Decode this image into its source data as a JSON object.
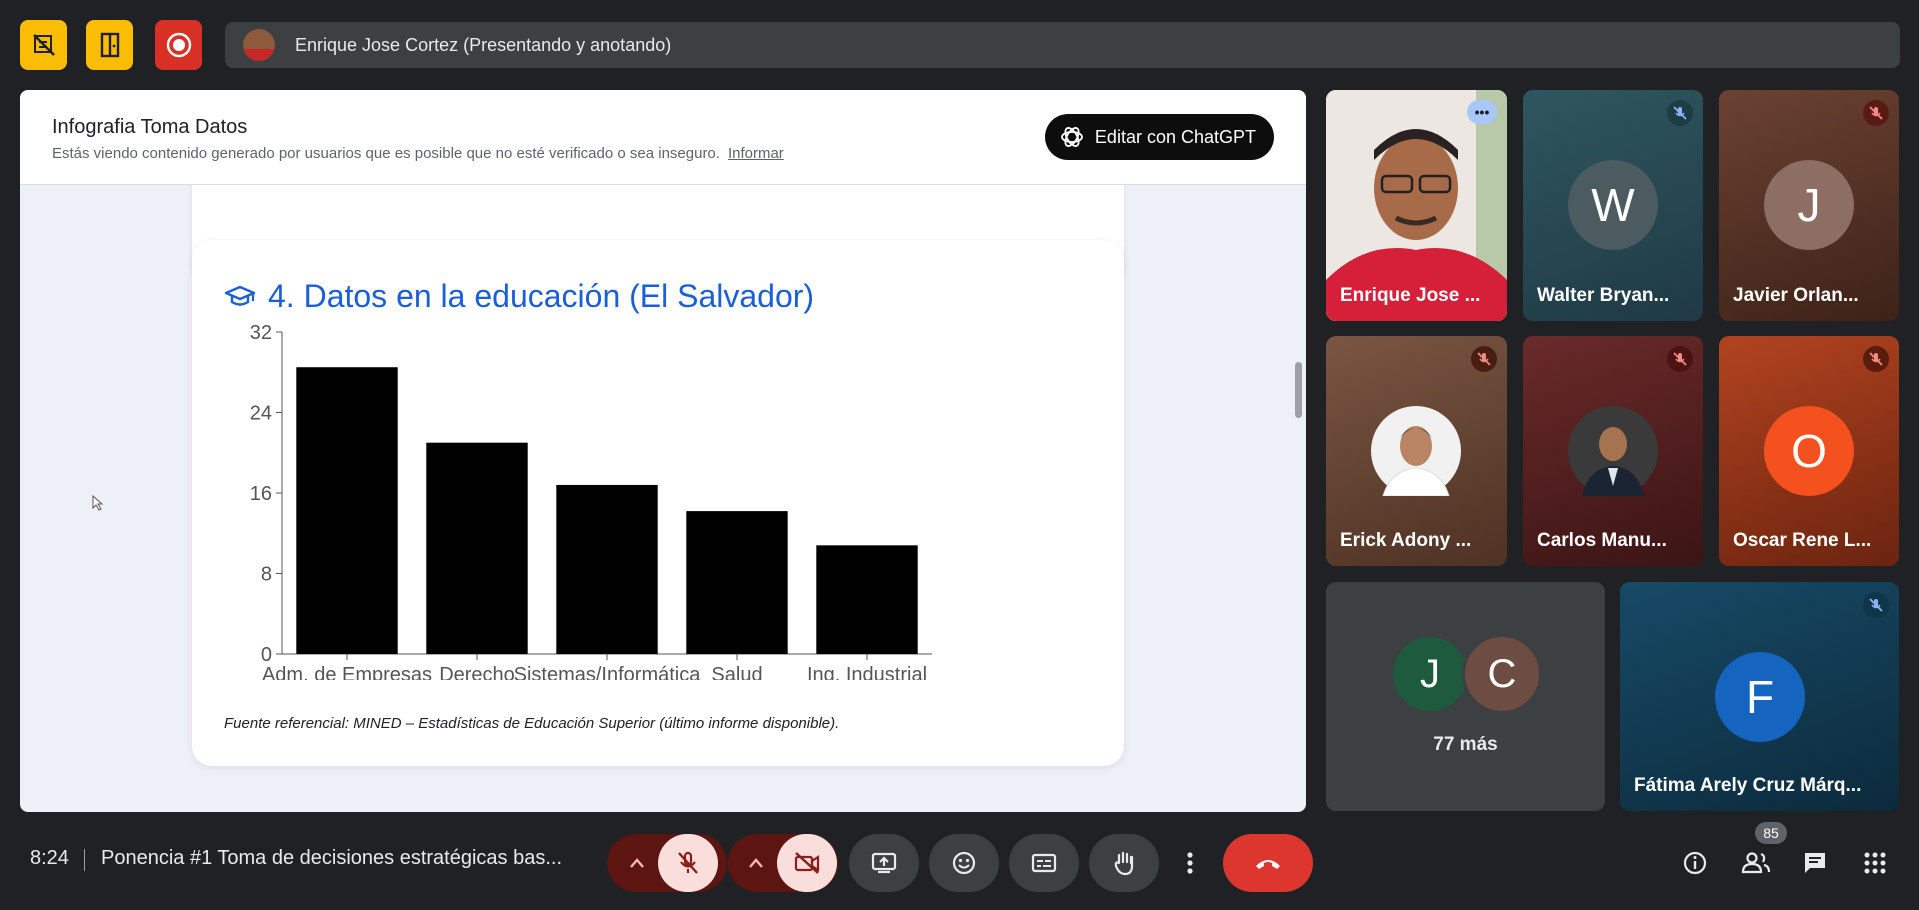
{
  "topbar": {
    "presenter_text": "Enrique Jose Cortez (Presentando y anotando)",
    "buttons": [
      "no-camera-zone-icon",
      "door-exit-icon",
      "record-icon"
    ]
  },
  "presentation": {
    "title": "Infografia Toma Datos",
    "warning": "Estás viendo contenido generado por usuarios que es posible que no esté verificado o sea inseguro.",
    "report_link": "Informar",
    "edit_button": "Editar con ChatGPT",
    "card": {
      "title": "4. Datos en la educación (El Salvador)",
      "source": "Fuente referencial: MINED – Estadísticas de Educación Superior (último informe disponible)."
    }
  },
  "chart_data": {
    "type": "bar",
    "categories": [
      "Adm. de Empresas",
      "Derecho",
      "Sistemas/Informática",
      "Salud",
      "Ing. Industrial"
    ],
    "values": [
      28.5,
      21,
      16.8,
      14.2,
      10.8
    ],
    "yticks": [
      "0",
      "8",
      "16",
      "24",
      "32"
    ],
    "ylim": [
      0,
      32
    ],
    "bar_color": "#000000"
  },
  "participants": [
    {
      "name": "Enrique Jose ...",
      "bg": "#b71c2c",
      "speaking": true
    },
    {
      "name": "Walter Bryan...",
      "initial": "W",
      "avatar_color": "#4a5a60",
      "bg": "#2b4d55"
    },
    {
      "name": "Javier Orlan...",
      "initial": "J",
      "avatar_color": "#8d6e63",
      "bg": "#5a3a2e"
    },
    {
      "name": "Erick Adony ...",
      "bg": "#6d4c3a"
    },
    {
      "name": "Carlos Manu...",
      "bg": "#5b2424"
    },
    {
      "name": "Oscar Rene L...",
      "initial": "O",
      "avatar_color": "#f4511e",
      "bg": "#a03818"
    },
    {
      "more_label": "77 más",
      "initials": [
        "J",
        "C"
      ]
    },
    {
      "name": "Fátima Arely Cruz Márq...",
      "initial": "F",
      "avatar_color": "#1565c0",
      "bg": "#123a55"
    }
  ],
  "bottombar": {
    "time": "8:24",
    "meeting_title": "Ponencia #1 Toma de decisiones estratégicas bas...",
    "people_count": "85"
  },
  "colors": {
    "accent": "#1a5fd6",
    "end_call": "#dc362e",
    "muted_bg": "#f9dedc"
  }
}
